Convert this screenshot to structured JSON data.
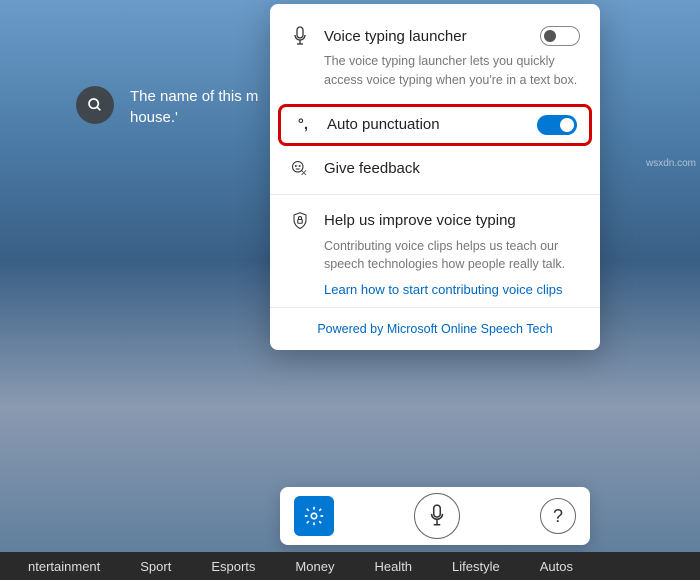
{
  "search": {
    "text_line1": "The name of this m",
    "text_line2": "house.'"
  },
  "panel": {
    "launcher": {
      "title": "Voice typing launcher",
      "desc": "The voice typing launcher lets you quickly access voice typing when you're in a text box.",
      "enabled": false
    },
    "punctuation": {
      "title": "Auto punctuation",
      "enabled": true
    },
    "feedback": {
      "title": "Give feedback"
    },
    "improve": {
      "title": "Help us improve voice typing",
      "desc": "Contributing voice clips helps us teach our speech technologies how people really talk.",
      "link": "Learn how to start contributing voice clips"
    },
    "footer": "Powered by Microsoft Online Speech Tech"
  },
  "nav": {
    "items": [
      "ntertainment",
      "Sport",
      "Esports",
      "Money",
      "Health",
      "Lifestyle",
      "Autos"
    ]
  },
  "watermark": "wsxdn.com"
}
